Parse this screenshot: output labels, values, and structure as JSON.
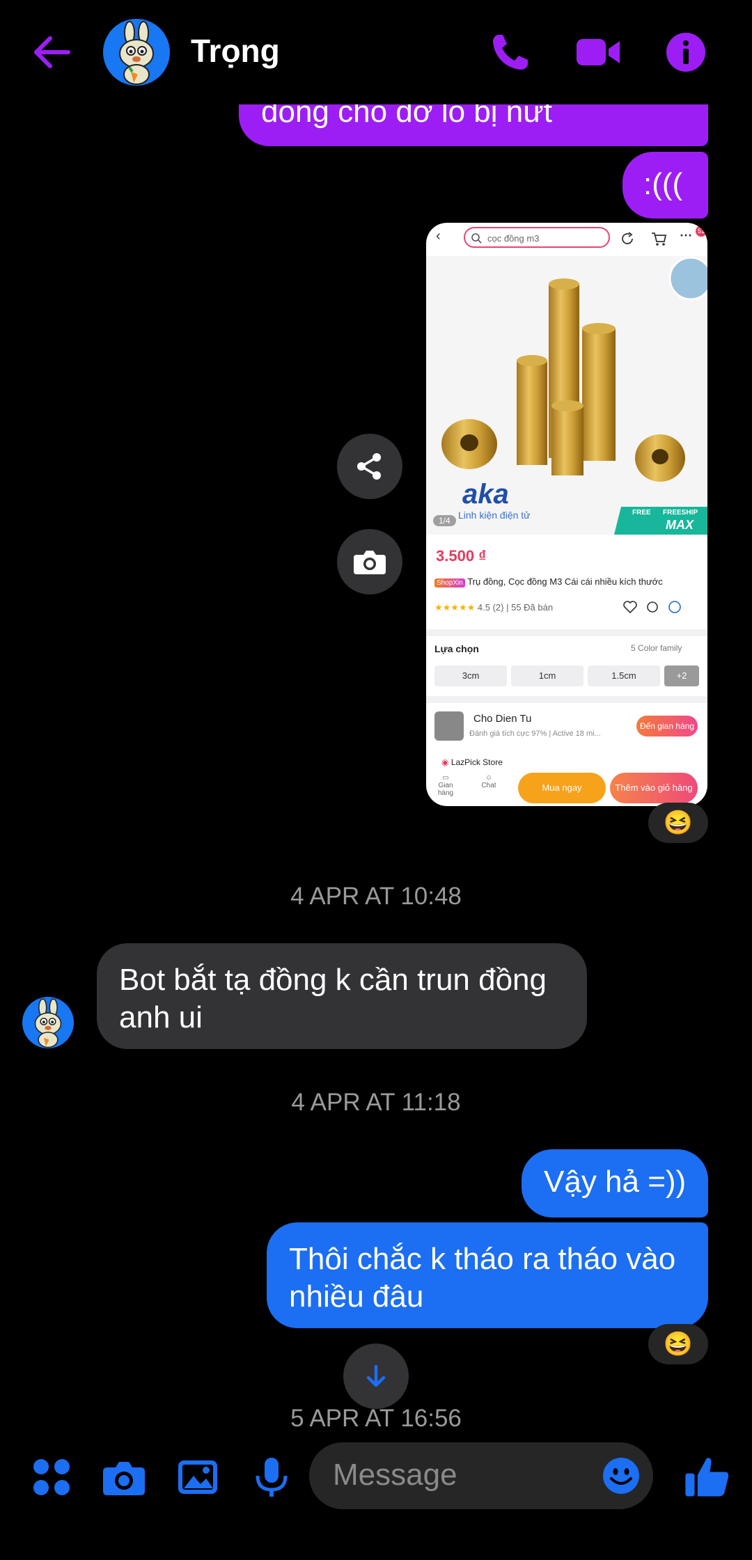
{
  "header": {
    "contact_name": "Trọng",
    "accent_color": "#9c1ef5",
    "icons": [
      "back-arrow-icon",
      "phone-icon",
      "video-call-icon",
      "info-icon"
    ]
  },
  "messages": [
    {
      "id": "m1",
      "sender": "me",
      "style": "purple",
      "text": "đồng cho đỡ lo bị nứt"
    },
    {
      "id": "m2",
      "sender": "me",
      "style": "purple",
      "text": ":((("
    },
    {
      "id": "m3",
      "sender": "me",
      "type": "image",
      "reaction": "😆"
    },
    {
      "id": "m4",
      "sender": "them",
      "style": "grey",
      "text": "Bot bắt tạ đồng k cần trun đồng anh ui"
    },
    {
      "id": "m5",
      "sender": "me",
      "style": "blue",
      "text": "Vậy hả =))"
    },
    {
      "id": "m6",
      "sender": "me",
      "style": "blue",
      "text": "Thôi chắc k tháo ra tháo vào nhiều đâu",
      "reaction": "😆"
    }
  ],
  "timestamps": [
    "4 APR AT 10:48",
    "4 APR AT 11:18",
    "5 APR AT 16:56"
  ],
  "reactions": {
    "image": "😆",
    "last": "😆"
  },
  "shared_screenshot": {
    "search_text": "cọc đồng m3",
    "cart_badge": "51",
    "brand_logo": "aka",
    "brand_tagline": "Linh kiện điện tử",
    "image_counter": "1/4",
    "freeship_label": "FREESHIP",
    "max_label": "MAX",
    "free_label": "FREE",
    "price": "3.500 ₫",
    "shop_badge": "ShopXin",
    "product_title": "Trụ đồng, Cọc đồng M3 Cái cái nhiều kích thước",
    "rating": "4.5 (2)",
    "sold": "55 Đã bán",
    "options_label": "Lựa chọn",
    "color_family": "5 Color family",
    "options": [
      "3cm",
      "1cm",
      "1.5cm",
      "+2"
    ],
    "store_name": "Cho Dien Tu",
    "store_stats": "Đánh giá tích cực 97%  |  Active 18 mi...",
    "store_button": "Đến gian hàng",
    "lazpick": "LazPick Store",
    "nav_shop": "Gian hàng",
    "nav_chat": "Chat",
    "buy_now": "Mua ngay",
    "add_cart": "Thêm vào giỏ hàng"
  },
  "composer": {
    "placeholder": "Message",
    "icons": [
      "apps-icon",
      "camera-icon",
      "gallery-icon",
      "microphone-icon",
      "emoji-icon",
      "like-icon"
    ],
    "color": "#1c6ef2"
  }
}
